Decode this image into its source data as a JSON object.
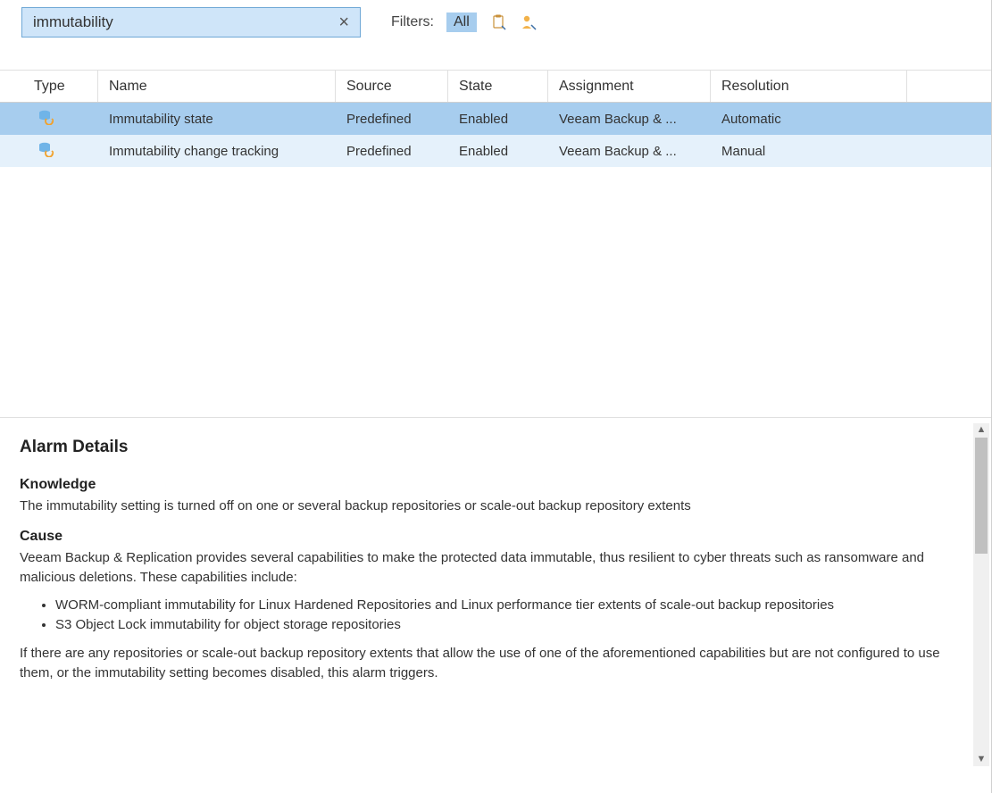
{
  "search": {
    "value": "immutability",
    "clear_icon": "×"
  },
  "filters": {
    "label": "Filters:",
    "all_label": "All"
  },
  "columns": {
    "type": "Type",
    "name": "Name",
    "source": "Source",
    "state": "State",
    "assignment": "Assignment",
    "resolution": "Resolution"
  },
  "rows": [
    {
      "name": "Immutability state",
      "source": "Predefined",
      "state": "Enabled",
      "assignment": "Veeam Backup & ...",
      "resolution": "Automatic"
    },
    {
      "name": "Immutability change tracking",
      "source": "Predefined",
      "state": "Enabled",
      "assignment": "Veeam Backup & ...",
      "resolution": "Manual"
    }
  ],
  "details": {
    "title": "Alarm Details",
    "knowledge_h": "Knowledge",
    "knowledge_p": "The immutability setting is turned off on one or several backup repositories or scale-out backup repository extents",
    "cause_h": "Cause",
    "cause_p1": "Veeam Backup & Replication provides several capabilities to make the protected data immutable, thus resilient to cyber threats such as ransomware and malicious deletions. These capabilities include:",
    "cause_li1": "WORM-compliant immutability for Linux Hardened Repositories and Linux performance tier extents of scale-out backup repositories",
    "cause_li2": "S3 Object Lock immutability for object storage repositories",
    "cause_p2": "If there are any repositories or scale-out backup repository extents that allow the use of one of the aforementioned capabilities but are not configured to use them, or the immutability setting becomes disabled, this alarm triggers."
  }
}
